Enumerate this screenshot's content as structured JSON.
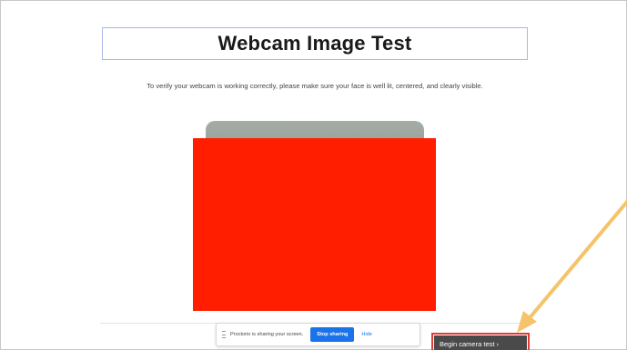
{
  "page": {
    "title": "Webcam Image Test",
    "instructions": "To verify your webcam is working correctly, please make sure your face is well lit, centered, and clearly visible."
  },
  "share_bar": {
    "message": "Proctorio is sharing your screen.",
    "stop_label": "Stop sharing",
    "hide_label": "Hide"
  },
  "actions": {
    "begin_label": "Begin camera test ›"
  },
  "colors": {
    "redaction": "#ff1e00",
    "annotation_arrow": "#f5c36a",
    "highlight_border": "#e53935",
    "stop_button": "#1a73e8",
    "begin_button": "#4a4a4a"
  },
  "icons": {
    "share_bar_handle": "grip-icon",
    "annotation": "arrow-icon"
  }
}
